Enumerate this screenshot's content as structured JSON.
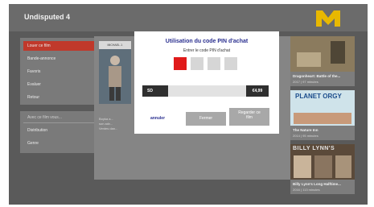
{
  "header": {
    "title": "Undisputed 4",
    "logo_label": "M"
  },
  "menu": {
    "items": [
      {
        "label": "Louer ce film",
        "active": true
      },
      {
        "label": "Bande-annonce",
        "active": false
      },
      {
        "label": "Favoris",
        "active": false
      },
      {
        "label": "Evaluer",
        "active": false
      },
      {
        "label": "Retour",
        "active": false
      }
    ],
    "section_title": "Avec ce film vous...",
    "section_items": [
      "Distribution",
      "Genre"
    ]
  },
  "poster": {
    "caption": "MICHAEL J."
  },
  "description": [
    "Boyka a...",
    "son adv...",
    "Ventes dan..."
  ],
  "modal": {
    "title": "Utilisation du code PIN d'achat",
    "subtitle": "Entrer le code PIN d'achat",
    "quality": "SD",
    "price": "€4,99",
    "cancel_label": "annuler",
    "close_label": "Fermer",
    "trailer_label": [
      "Regarder ce",
      "film"
    ]
  },
  "suggestions": [
    {
      "title": "Dragonheart: Battle of the...",
      "sub": "2017 | 97 minutes"
    },
    {
      "title": "The Nature Inn",
      "sub": "2014 | 95 minutes",
      "poster_text": "PLANET ORGY"
    },
    {
      "title": "Billy Lynn's Long Halftime...",
      "sub": "2016 | 113 minutes",
      "poster_text": "BILLY LYNN'S"
    }
  ],
  "colors": {
    "accent": "#c0392b",
    "pin_active": "#e01a1a",
    "modal_title": "#2a2f8f"
  }
}
